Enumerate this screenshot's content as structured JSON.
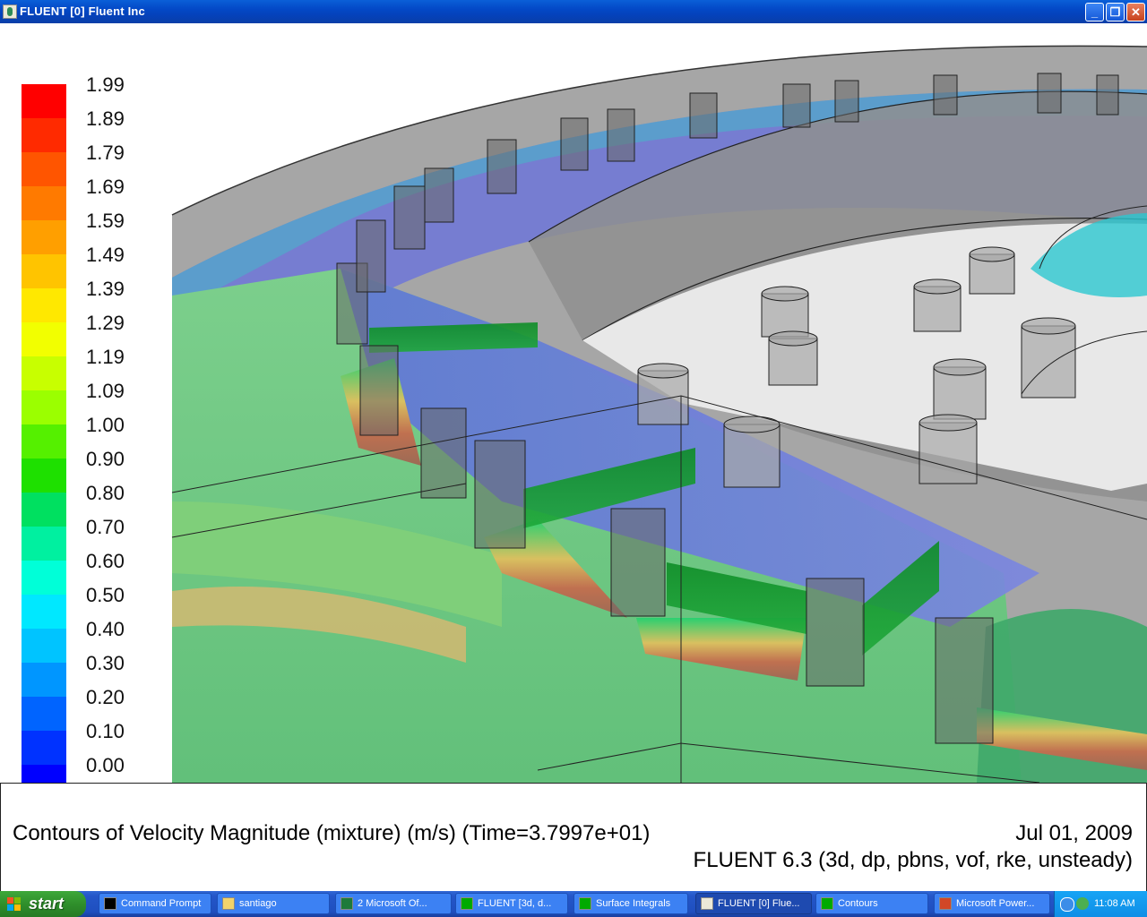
{
  "window": {
    "title": "FLUENT [0] Fluent Inc",
    "minimize_glyph": "_",
    "maximize_glyph": "❐",
    "close_glyph": "✕"
  },
  "legend": {
    "labels": [
      "1.99",
      "1.89",
      "1.79",
      "1.69",
      "1.59",
      "1.49",
      "1.39",
      "1.29",
      "1.19",
      "1.09",
      "1.00",
      "0.90",
      "0.80",
      "0.70",
      "0.60",
      "0.50",
      "0.40",
      "0.30",
      "0.20",
      "0.10",
      "0.00"
    ],
    "colors": [
      "#ff0000",
      "#ff2a00",
      "#ff5500",
      "#ff7a00",
      "#ff9f00",
      "#ffc400",
      "#ffe800",
      "#f2ff00",
      "#c8ff00",
      "#9bff00",
      "#55f000",
      "#1ee000",
      "#00e060",
      "#00f0a0",
      "#00ffd8",
      "#00e8ff",
      "#00c4ff",
      "#0096ff",
      "#0064ff",
      "#0032ff",
      "#0000ff"
    ]
  },
  "caption": {
    "description": "Contours of Velocity Magnitude (mixture)  (m/s)  (Time=3.7997e+01)",
    "date": "Jul 01, 2009",
    "version": "FLUENT 6.3 (3d, dp, pbns, vof, rke, unsteady)"
  },
  "taskbar": {
    "start_label": "start",
    "tasks": [
      {
        "label": "Command Prompt",
        "icon": "command-prompt-icon"
      },
      {
        "label": "santiago",
        "icon": "folder-icon"
      },
      {
        "label": "2 Microsoft Of...",
        "icon": "excel-icon"
      },
      {
        "label": "FLUENT  [3d, d...",
        "icon": "fluent-icon"
      },
      {
        "label": "Surface Integrals",
        "icon": "fluent-icon"
      },
      {
        "label": "FLUENT [0] Flue...",
        "icon": "fluent-icon"
      },
      {
        "label": "Contours",
        "icon": "fluent-icon"
      },
      {
        "label": "Microsoft Power...",
        "icon": "powerpoint-icon"
      }
    ],
    "clock": "11:08 AM"
  }
}
